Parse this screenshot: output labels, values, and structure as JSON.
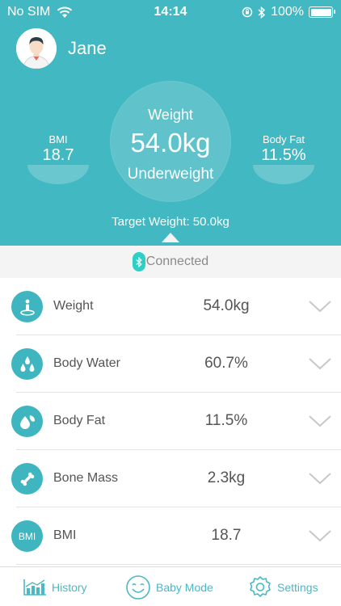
{
  "status_bar": {
    "carrier": "No SIM",
    "time": "14:14",
    "battery": "100%",
    "battery_level": 1.0
  },
  "profile": {
    "name": "Jane"
  },
  "summary": {
    "weight_label": "Weight",
    "weight_value": "54.0kg",
    "weight_status": "Underweight",
    "bmi_label": "BMI",
    "bmi_value": "18.7",
    "body_fat_label": "Body Fat",
    "body_fat_value": "11.5%",
    "target": "Target Weight: 50.0kg"
  },
  "connection": {
    "status": "Connected"
  },
  "metrics": [
    {
      "label": "Weight",
      "value": "54.0kg",
      "icon": "scale-person-icon"
    },
    {
      "label": "Body Water",
      "value": "60.7%",
      "icon": "water-drops-icon"
    },
    {
      "label": "Body Fat",
      "value": "11.5%",
      "icon": "fat-drops-icon"
    },
    {
      "label": "Bone Mass",
      "value": "2.3kg",
      "icon": "bone-icon"
    },
    {
      "label": "BMI",
      "value": "18.7",
      "icon": "bmi-icon",
      "icon_text": "BMI"
    }
  ],
  "tabs": [
    {
      "label": "History",
      "icon": "bar-chart-icon"
    },
    {
      "label": "Baby Mode",
      "icon": "smiley-icon"
    },
    {
      "label": "Settings",
      "icon": "gear-icon"
    }
  ],
  "colors": {
    "primary": "#42b8c2",
    "accent": "#2ecfc4",
    "icon_bg": "#3fb5c0"
  }
}
